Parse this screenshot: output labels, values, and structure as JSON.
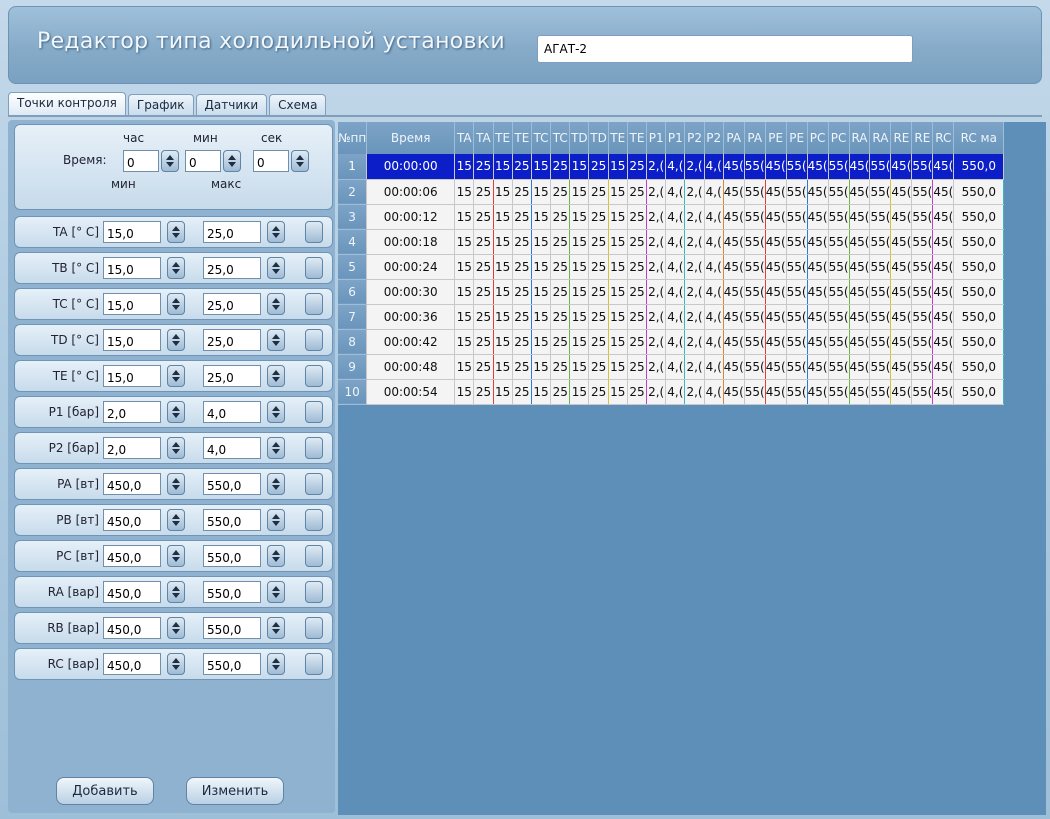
{
  "header": {
    "title": "Редактор типа холодильной установки",
    "type_value": "АГАТ-2"
  },
  "tabs": [
    {
      "label": "Точки контроля"
    },
    {
      "label": "График"
    },
    {
      "label": "Датчики"
    },
    {
      "label": "Схема"
    }
  ],
  "time": {
    "label": "Время:",
    "hour_label": "час",
    "minute_label": "мин",
    "second_label": "сек",
    "hour": "0",
    "minute": "0",
    "second": "0",
    "min_label": "мин",
    "max_label": "макс"
  },
  "params": [
    {
      "label": "TA [° C]",
      "min": "15,0",
      "max": "25,0"
    },
    {
      "label": "TB [° C]",
      "min": "15,0",
      "max": "25,0"
    },
    {
      "label": "TC [° C]",
      "min": "15,0",
      "max": "25,0"
    },
    {
      "label": "TD [° C]",
      "min": "15,0",
      "max": "25,0"
    },
    {
      "label": "TE [° C]",
      "min": "15,0",
      "max": "25,0"
    },
    {
      "label": "P1 [бар]",
      "min": "2,0",
      "max": "4,0"
    },
    {
      "label": "P2 [бар]",
      "min": "2,0",
      "max": "4,0"
    },
    {
      "label": "PA [вт]",
      "min": "450,0",
      "max": "550,0"
    },
    {
      "label": "PB [вт]",
      "min": "450,0",
      "max": "550,0"
    },
    {
      "label": "PC [вт]",
      "min": "450,0",
      "max": "550,0"
    },
    {
      "label": "RA [вар]",
      "min": "450,0",
      "max": "550,0"
    },
    {
      "label": "RB [вар]",
      "min": "450,0",
      "max": "550,0"
    },
    {
      "label": "RC [вар]",
      "min": "450,0",
      "max": "550,0"
    }
  ],
  "buttons": {
    "add": "Добавить",
    "edit": "Изменить"
  },
  "table": {
    "headers": [
      "№пп",
      "Время",
      "TA",
      "TA",
      "TE",
      "TE",
      "TC",
      "TC",
      "TD",
      "TD",
      "TE",
      "TE",
      "P1",
      "P1",
      "P2",
      "P2",
      "PA",
      "PA",
      "PE",
      "PE",
      "PC",
      "PC",
      "RA",
      "RA",
      "RE",
      "RE",
      "RC",
      "RC ма"
    ],
    "rows": [
      {
        "n": "1",
        "time": "00:00:00"
      },
      {
        "n": "2",
        "time": "00:00:06"
      },
      {
        "n": "3",
        "time": "00:00:12"
      },
      {
        "n": "4",
        "time": "00:00:18"
      },
      {
        "n": "5",
        "time": "00:00:24"
      },
      {
        "n": "6",
        "time": "00:00:30"
      },
      {
        "n": "7",
        "time": "00:00:36"
      },
      {
        "n": "8",
        "time": "00:00:42"
      },
      {
        "n": "9",
        "time": "00:00:48"
      },
      {
        "n": "10",
        "time": "00:00:54"
      }
    ],
    "cell_values": [
      "15",
      "25",
      "15",
      "25",
      "15",
      "25",
      "15",
      "25",
      "15",
      "25",
      "2,(",
      "4,(",
      "2,(",
      "4,(",
      "45(",
      "55(",
      "45(",
      "55(",
      "45(",
      "55(",
      "45(",
      "55(",
      "45(",
      "55(",
      "45(",
      "550,0"
    ],
    "selected_row_color": "#0b1ec8"
  }
}
